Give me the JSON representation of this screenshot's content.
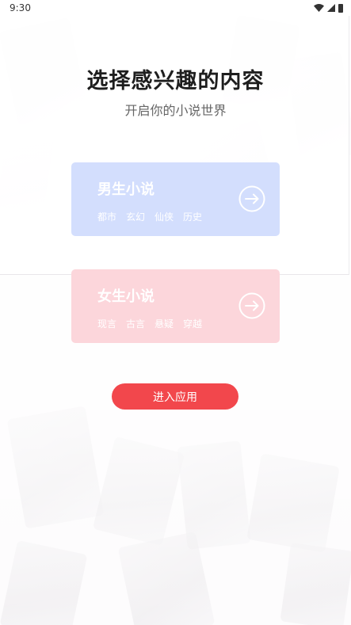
{
  "status_bar": {
    "time": "9:30",
    "icons": [
      "wifi-icon",
      "signal-icon",
      "battery-icon"
    ]
  },
  "header": {
    "title": "选择感兴趣的内容",
    "subtitle": "开启你的小说世界"
  },
  "cards": {
    "male": {
      "title": "男生小说",
      "tags": [
        "都市",
        "玄幻",
        "仙侠",
        "历史"
      ],
      "icon": "arrow-right-circle-icon",
      "color": "#d3defd"
    },
    "female": {
      "title": "女生小说",
      "tags": [
        "现言",
        "古言",
        "悬疑",
        "穿越"
      ],
      "icon": "arrow-right-circle-icon",
      "color": "#fcd6db"
    }
  },
  "actions": {
    "enter_label": "进入应用",
    "enter_color": "#f2474c"
  }
}
